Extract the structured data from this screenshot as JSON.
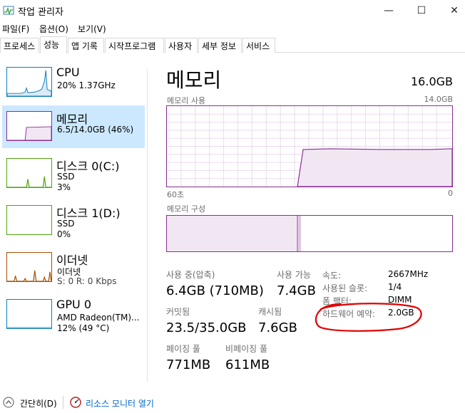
{
  "window": {
    "title": "작업 관리자",
    "minimize": "—",
    "maximize": "☐",
    "close": "✕"
  },
  "menu": [
    "파일(F)",
    "옵션(O)",
    "보기(V)"
  ],
  "tabs": [
    "프로세스",
    "성능",
    "앱 기록",
    "시작프로그램",
    "사용자",
    "세부 정보",
    "서비스"
  ],
  "sidebar": [
    {
      "title": "CPU",
      "sub1": "20% 1.37GHz",
      "sub2": "",
      "color": "#117dbb",
      "icon": "cpu-thumbnail"
    },
    {
      "title": "메모리",
      "sub1": "6.5/14.0GB (46%)",
      "sub2": "",
      "color": "#8b2d95",
      "icon": "memory-thumbnail"
    },
    {
      "title": "디스크 0(C:)",
      "sub1": "SSD",
      "sub2": "3%",
      "color": "#4da60c",
      "icon": "disk0-thumbnail"
    },
    {
      "title": "디스크 1(D:)",
      "sub1": "SSD",
      "sub2": "0%",
      "color": "#4da60c",
      "icon": "disk1-thumbnail"
    },
    {
      "title": "이더넷",
      "sub1": "이더넷",
      "sub2": "S: 0 R: 0 Kbps",
      "color": "#a74f01",
      "icon": "ethernet-thumbnail"
    },
    {
      "title": "GPU 0",
      "sub1": "AMD Radeon(TM)...",
      "sub2": "12% (49 °C)",
      "color": "#117dbb",
      "icon": "gpu-thumbnail"
    }
  ],
  "main": {
    "title": "메모리",
    "total": "16.0GB",
    "usage_label": "메모리 사용",
    "usage_max": "14.0GB",
    "axis_left": "60초",
    "axis_right": "0",
    "composition_label": "메모리 구성"
  },
  "stats": {
    "in_use_label": "사용 중(압축)",
    "in_use_value": "6.4GB (710MB)",
    "available_label": "사용 가능",
    "available_value": "7.4GB",
    "committed_label": "커밋됨",
    "committed_value": "23.5/35.0GB",
    "cached_label": "캐시됨",
    "cached_value": "7.6GB",
    "paged_label": "페이징 풀",
    "paged_value": "771MB",
    "nonpaged_label": "비페이징 풀",
    "nonpaged_value": "611MB"
  },
  "details": [
    {
      "label": "속도:",
      "value": "2667MHz"
    },
    {
      "label": "사용된 슬롯:",
      "value": "1/4"
    },
    {
      "label": "폼 팩터:",
      "value": "DIMM"
    },
    {
      "label": "하드웨어 예약:",
      "value": "2.0GB"
    }
  ],
  "bottom": {
    "fewer_details": "간단히(D)",
    "resource_monitor": "리소스 모니터 열기"
  },
  "colors": {
    "memory": "#8b2d95",
    "annotation": "#e00000",
    "selected": "#cce8ff",
    "link": "#0066cc"
  },
  "memory_graph": {
    "current_percent": 46,
    "start_percent": 0
  }
}
